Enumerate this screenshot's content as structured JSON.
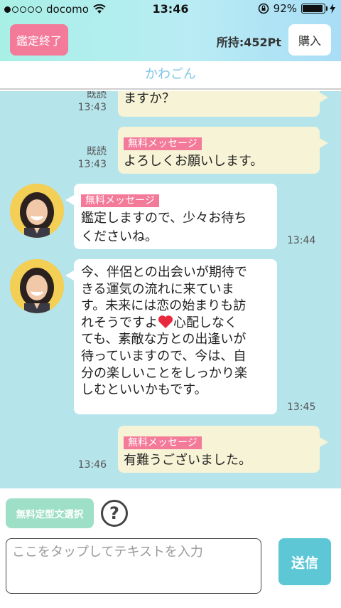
{
  "status": {
    "carrier": "docomo",
    "time": "13:46",
    "battery": "92%",
    "battery_level": 0.92
  },
  "header": {
    "end_button": "鑑定終了",
    "points": "所持:452Pt",
    "buy_button": "購入",
    "name": "かわごん"
  },
  "messages": {
    "m1": {
      "read": "既読",
      "time": "13:43",
      "lines": [
        "ますか？"
      ]
    },
    "m2": {
      "read": "既読",
      "time": "13:43",
      "tag": "無料メッセージ",
      "lines": [
        "よろしくお願いします。"
      ]
    },
    "m3": {
      "time": "13:44",
      "tag": "無料メッセージ",
      "lines": [
        "鑑定しますので、少々お待ち",
        "くださいね。"
      ]
    },
    "m4": {
      "time": "13:45",
      "lines": [
        "今、伴侶との出会いが期待で",
        "きる運気の流れに来ていま",
        "す。未来には恋の始まりも訪",
        "れそうですよ",
        "心配しなく",
        "ても、素敵な方との出逢いが",
        "待っていますので、今は、自",
        "分の楽しいことをしっかり楽",
        "しむといいかもです。"
      ]
    },
    "m5": {
      "time": "13:46",
      "tag": "無料メッセージ",
      "lines": [
        "有難うございました。"
      ]
    }
  },
  "footer": {
    "template_button": "無料定型文選択",
    "help": "?",
    "input_placeholder": "ここをタップしてテキストを入力",
    "send_button": "送信"
  },
  "colors": {
    "accent_pink": "#f47a9a",
    "chat_bg": "#b6e4eb",
    "send": "#5dc7d6",
    "template": "#9ee0c7"
  },
  "icons": [
    "wifi-icon",
    "lock-rotation-icon",
    "battery-icon",
    "charging-icon",
    "heart-icon",
    "avatar-image",
    "help-icon"
  ]
}
